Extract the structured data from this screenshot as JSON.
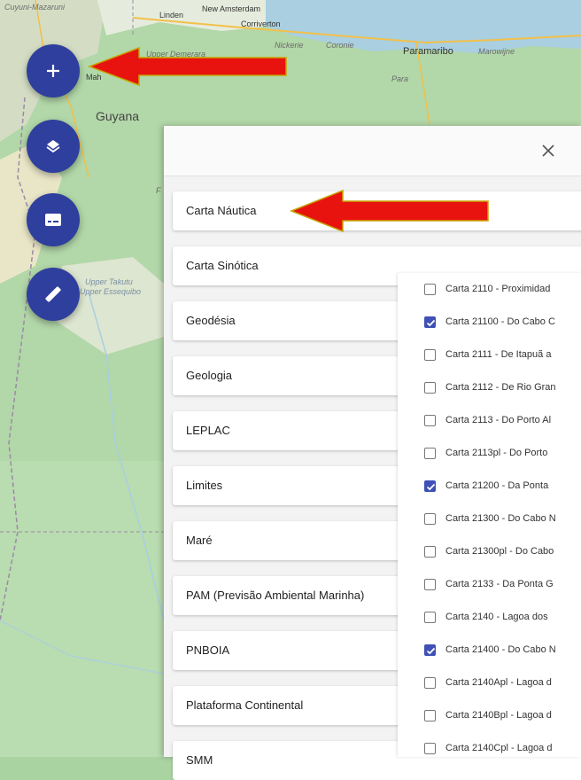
{
  "map": {
    "labels": {
      "cuyuni": "Cuyuni-Mazaruni",
      "linden": "Linden",
      "new_amsterdam": "New Amsterdam",
      "corriverton": "Corriverton",
      "upper_demerara": "Upper Demerara",
      "nickerie": "Nickerie",
      "coronie": "Coronie",
      "paramaribo": "Paramaribo",
      "marowijne": "Marowijne",
      "para": "Para",
      "guyana": "Guyana",
      "mahaica": "Mah",
      "upper_takutu": "Upper Takutu",
      "upper_essequibo": "Upper Essequibo",
      "frag": "F"
    },
    "colors": {
      "land": "#aad3a2",
      "water": "#a9cfe0",
      "road": "#f2c04a"
    }
  },
  "fabs": [
    {
      "icon": "plus-icon"
    },
    {
      "icon": "layers-icon"
    },
    {
      "icon": "subtitles-icon"
    },
    {
      "icon": "ruler-icon"
    }
  ],
  "panel": {
    "close_label": "×",
    "categories": [
      "Carta Náutica",
      "Carta Sinótica",
      "Geodésia",
      "Geologia",
      "LEPLAC",
      "Limites",
      "Maré",
      "PAM (Previsão Ambiental Marinha)",
      "PNBOIA",
      "Plataforma Continental",
      "SMM"
    ],
    "charts": [
      {
        "label": "Carta 2110 - Proximidad",
        "checked": false
      },
      {
        "label": "Carta 21100 - Do Cabo C",
        "checked": true
      },
      {
        "label": "Carta 2111 - De Itapuã a",
        "checked": false
      },
      {
        "label": "Carta 2112 - De Rio Gran",
        "checked": false
      },
      {
        "label": "Carta 2113 - Do Porto Al",
        "checked": false
      },
      {
        "label": "Carta 2113pl - Do Porto",
        "checked": false
      },
      {
        "label": "Carta 21200 - Da Ponta",
        "checked": true
      },
      {
        "label": "Carta 21300 - Do Cabo N",
        "checked": false
      },
      {
        "label": "Carta 21300pl - Do Cabo",
        "checked": false
      },
      {
        "label": "Carta 2133 - Da Ponta G",
        "checked": false
      },
      {
        "label": "Carta 2140 - Lagoa dos",
        "checked": false
      },
      {
        "label": "Carta 21400 - Do Cabo N",
        "checked": true
      },
      {
        "label": "Carta 2140Apl - Lagoa d",
        "checked": false
      },
      {
        "label": "Carta 2140Bpl - Lagoa d",
        "checked": false
      },
      {
        "label": "Carta 2140Cpl - Lagoa d",
        "checked": false
      }
    ]
  },
  "annotation_color": "#e8130f",
  "accent_color": "#2f3f9d"
}
